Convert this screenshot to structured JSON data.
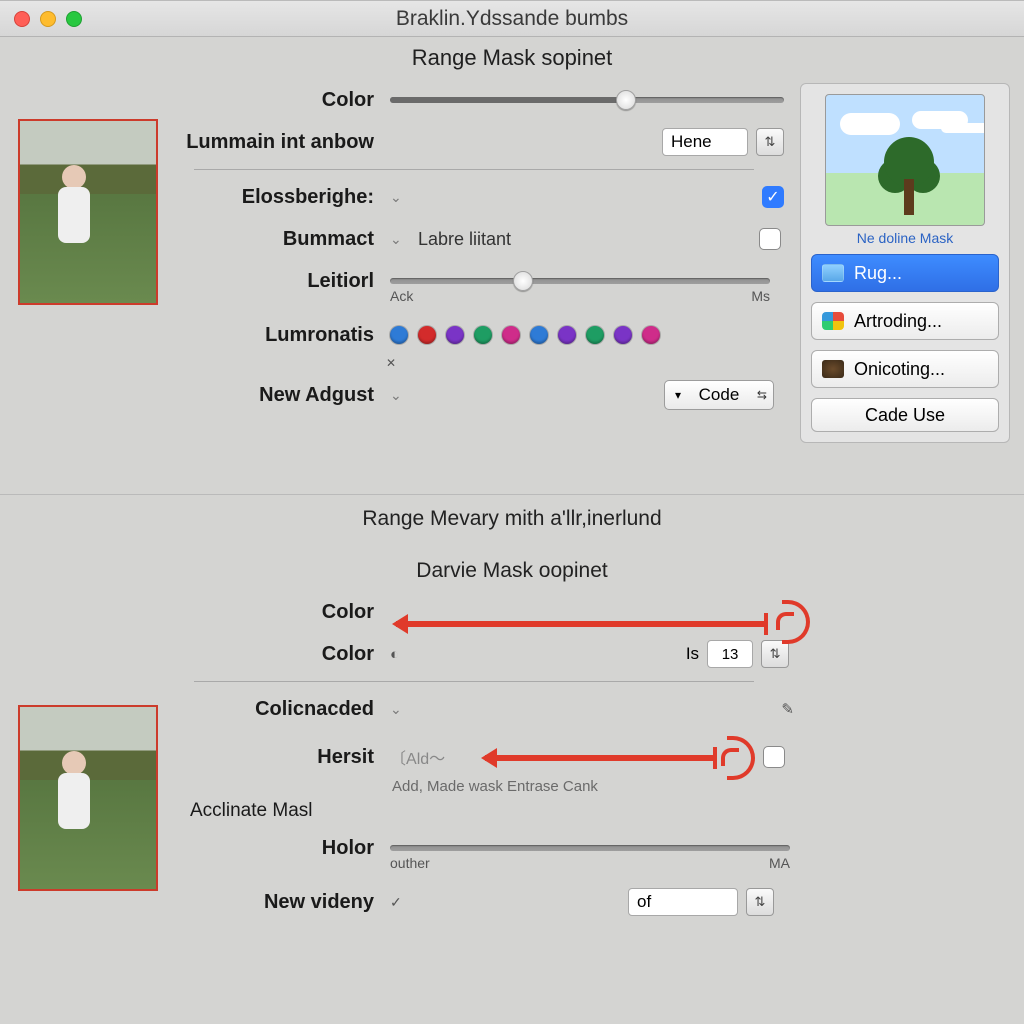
{
  "window": {
    "title": "Braklin.Ydssande bumbs"
  },
  "panelA": {
    "heading": "Range Mask sopinet",
    "rows": {
      "color_label": "Color",
      "color_slider_pct": 60,
      "lummain_label": "Lummain int anbow",
      "lummain_value": "Hene",
      "eloss_label": "Elossberighe:",
      "eloss_checked": true,
      "bummact_label": "Bummact",
      "bummact_inline": "Labre liitant",
      "bummact_checked": false,
      "leitiorl_label": "Leitiorl",
      "leitiorl_pct": 35,
      "leitiorl_left": "Ack",
      "leitiorl_right": "Ms",
      "lumronatis_label": "Lumronatis",
      "lumronatis_colors": [
        "#2e7bd6",
        "#d32b2b",
        "#7a34c6",
        "#1e9d63",
        "#cf2c8a",
        "#2e7bd6",
        "#7a34c6",
        "#1e9d63",
        "#7a34c6",
        "#cf2c8a"
      ],
      "newadj_label": "New Adgust",
      "newadj_value": "Code"
    },
    "sidebar": {
      "preview_caption": "Ne doline Mask",
      "items": [
        {
          "label": "Rug...",
          "selected": true
        },
        {
          "label": "Artroding...",
          "selected": false
        },
        {
          "label": "Onicoting...",
          "selected": false
        }
      ],
      "action": "Cade Use"
    }
  },
  "panelB": {
    "title": "Range Mevary mith a'llr,inerlund",
    "heading": "Darvie Mask oopinet",
    "rows": {
      "color_a_label": "Color",
      "color_b_label": "Color",
      "color_b_is": "Is",
      "color_b_value": "13",
      "colic_label": "Colicnacded",
      "hersit_label": "Hersit",
      "hersit_inline": "Ald",
      "hersit_help": "Add, Made wask Entrase Cank",
      "hersit_checked": false,
      "acclinate_label": "Acclinate Masl",
      "holor_label": "Holor",
      "holor_left": "outher",
      "holor_right": "MA",
      "holor_pct": 0,
      "newvid_label": "New videny",
      "newvid_value": "of"
    }
  }
}
